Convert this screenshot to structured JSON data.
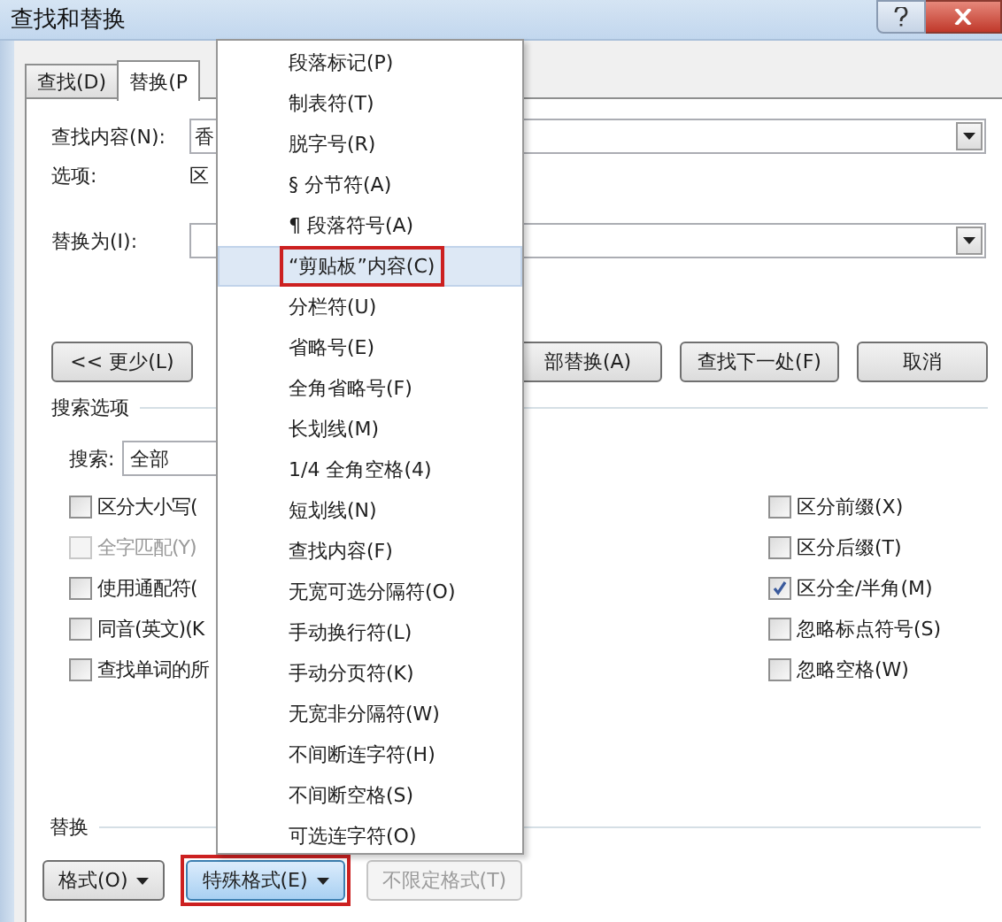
{
  "window": {
    "title": "查找和替换"
  },
  "tabs": [
    {
      "label": "查找(D)",
      "selected": false
    },
    {
      "label": "替换(P",
      "selected": true
    }
  ],
  "find": {
    "label": "查找内容(N):",
    "value": "香"
  },
  "options": {
    "label": "选项:",
    "value": "区"
  },
  "replace": {
    "label": "替换为(I):"
  },
  "buttons": [
    {
      "label": "<< 更少(L)"
    },
    {
      "label": "部替换(A)"
    },
    {
      "label": "查找下一处(F)"
    },
    {
      "label": "取消"
    }
  ],
  "search_options": {
    "title": "搜索选项",
    "search_label": "搜索:",
    "search_value": "全部",
    "left": [
      {
        "label": "区分大小写(",
        "checked": false,
        "disabled": false
      },
      {
        "label": "全字匹配(Y)",
        "checked": false,
        "disabled": true
      },
      {
        "label": "使用通配符(",
        "checked": false,
        "disabled": false
      },
      {
        "label": "同音(英文)(K",
        "checked": false,
        "disabled": false
      },
      {
        "label": "查找单词的所",
        "checked": false,
        "disabled": false
      }
    ],
    "right": [
      {
        "label": "区分前缀(X)",
        "checked": false,
        "disabled": false
      },
      {
        "label": "区分后缀(T)",
        "checked": false,
        "disabled": false
      },
      {
        "label": "区分全/半角(M)",
        "checked": true,
        "disabled": false
      },
      {
        "label": "忽略标点符号(S)",
        "checked": false,
        "disabled": false
      },
      {
        "label": "忽略空格(W)",
        "checked": false,
        "disabled": false
      }
    ]
  },
  "replace_section": {
    "title": "替换",
    "buttons": [
      {
        "label": "格式(O)",
        "kind": "dropdown",
        "pressed": false,
        "disabled": false,
        "annotated": false
      },
      {
        "label": "特殊格式(E)",
        "kind": "dropdown",
        "pressed": true,
        "disabled": false,
        "annotated": true
      },
      {
        "label": "不限定格式(T)",
        "kind": "plain",
        "pressed": false,
        "disabled": true,
        "annotated": false
      }
    ]
  },
  "menu": {
    "items": [
      {
        "label": "段落标记(P)",
        "selected": false,
        "annotated": false
      },
      {
        "label": "制表符(T)",
        "selected": false,
        "annotated": false
      },
      {
        "label": "脱字号(R)",
        "selected": false,
        "annotated": false
      },
      {
        "label": "§ 分节符(A)",
        "selected": false,
        "annotated": false
      },
      {
        "label": "¶ 段落符号(A)",
        "selected": false,
        "annotated": false
      },
      {
        "label": "“剪贴板”内容(C)",
        "selected": true,
        "annotated": true
      },
      {
        "label": "分栏符(U)",
        "selected": false,
        "annotated": false
      },
      {
        "label": "省略号(E)",
        "selected": false,
        "annotated": false
      },
      {
        "label": "全角省略号(F)",
        "selected": false,
        "annotated": false
      },
      {
        "label": "长划线(M)",
        "selected": false,
        "annotated": false
      },
      {
        "label": "1/4 全角空格(4)",
        "selected": false,
        "annotated": false
      },
      {
        "label": "短划线(N)",
        "selected": false,
        "annotated": false
      },
      {
        "label": "查找内容(F)",
        "selected": false,
        "annotated": false
      },
      {
        "label": "无宽可选分隔符(O)",
        "selected": false,
        "annotated": false
      },
      {
        "label": "手动换行符(L)",
        "selected": false,
        "annotated": false
      },
      {
        "label": "手动分页符(K)",
        "selected": false,
        "annotated": false
      },
      {
        "label": "无宽非分隔符(W)",
        "selected": false,
        "annotated": false
      },
      {
        "label": "不间断连字符(H)",
        "selected": false,
        "annotated": false
      },
      {
        "label": "不间断空格(S)",
        "selected": false,
        "annotated": false
      },
      {
        "label": "可选连字符(O)",
        "selected": false,
        "annotated": false
      }
    ]
  }
}
